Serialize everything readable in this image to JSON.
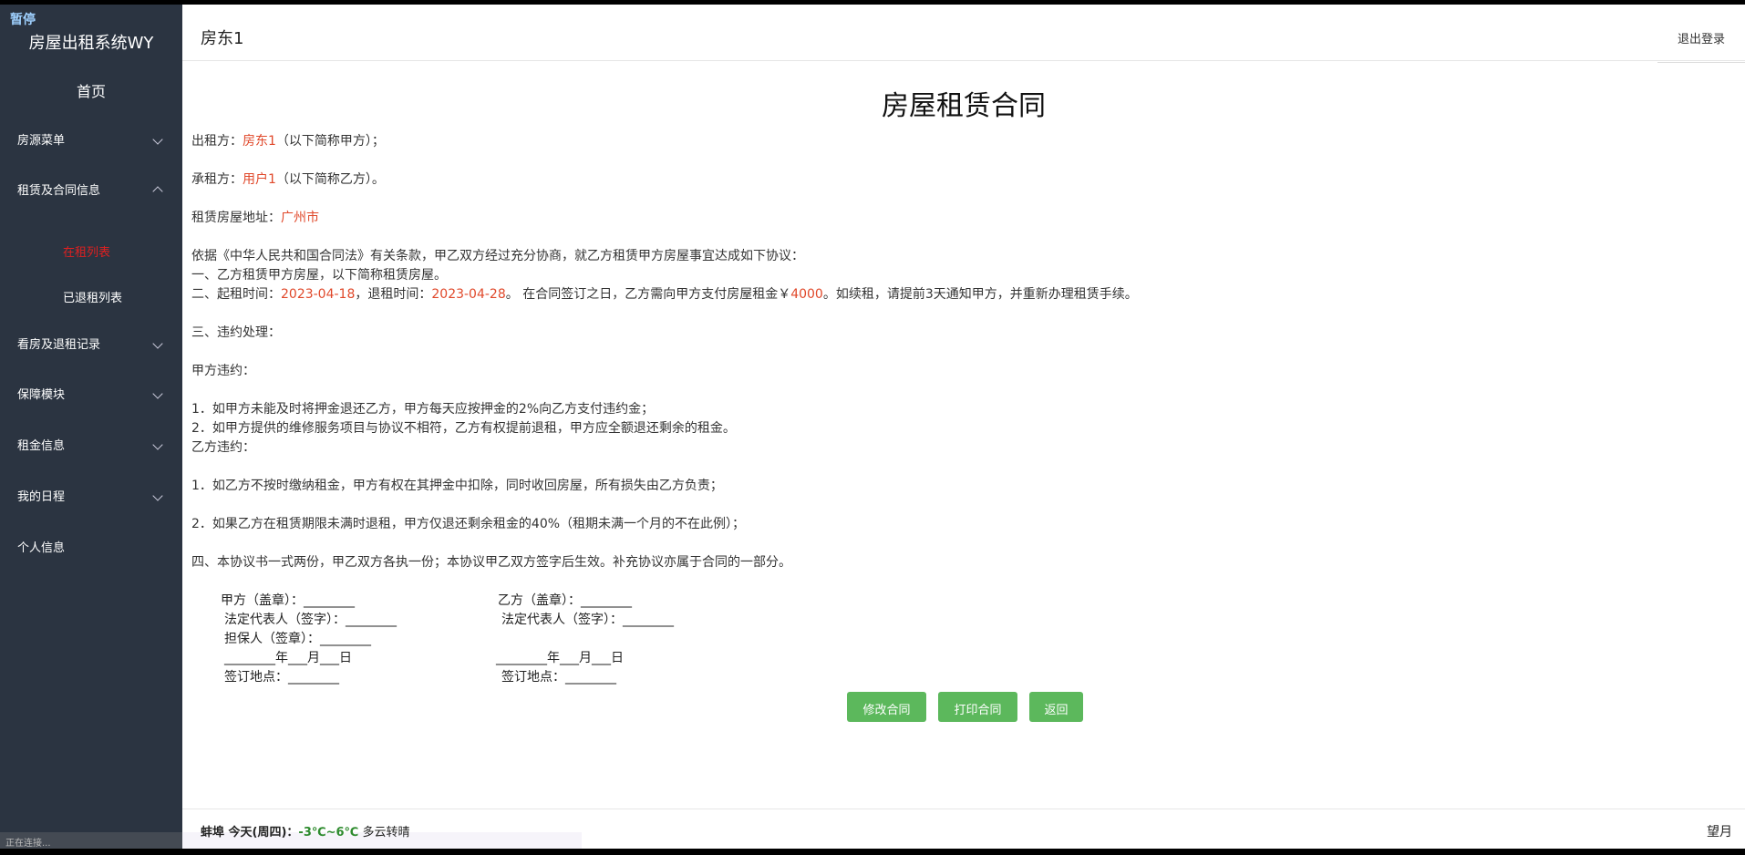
{
  "overlay": {
    "paused": "暂停"
  },
  "sidebar": {
    "app_title": "房屋出租系统WY",
    "home": "首页",
    "menus": [
      {
        "label": "房源菜单",
        "expanded": false
      },
      {
        "label": "租赁及合同信息",
        "expanded": true
      },
      {
        "label": "看房及退租记录",
        "expanded": false
      },
      {
        "label": "保障模块",
        "expanded": false
      },
      {
        "label": "租金信息",
        "expanded": false
      },
      {
        "label": "我的日程",
        "expanded": false
      },
      {
        "label": "个人信息",
        "expanded": false
      }
    ],
    "submenu": [
      {
        "label": "在租列表",
        "active": true
      },
      {
        "label": "已退租列表",
        "active": false
      }
    ],
    "status": "正在连接..."
  },
  "header": {
    "user": "房东1",
    "logout": "退出登录"
  },
  "contract": {
    "title": "房屋租赁合同",
    "lessor_prefix": "出租方：",
    "lessor": "房东1",
    "lessor_suffix": "（以下简称甲方）；",
    "lessee_prefix": "承租方：",
    "lessee": "用户1",
    "lessee_suffix": "（以下简称乙方）。",
    "address_prefix": "租赁房屋地址：",
    "address": "广州市",
    "intro": "依据《中华人民共和国合同法》有关条款，甲乙双方经过充分协商，就乙方租赁甲方房屋事宜达成如下协议：",
    "clause1": "一、乙方租赁甲方房屋，以下简称租赁房屋。",
    "clause2_a": "二、起租时间：",
    "start_date": "2023-04-18",
    "clause2_b": "，退租时间：",
    "end_date": "2023-04-28",
    "clause2_c": "。 在合同签订之日，乙方需向甲方支付房屋租金￥",
    "rent": "4000",
    "clause2_d": "。如续租，请提前3天通知甲方，并重新办理租赁手续。",
    "clause3": "三、违约处理：",
    "partyA_breach": "甲方违约：",
    "a1": "1．如甲方未能及时将押金退还乙方，甲方每天应按押金的2%向乙方支付违约金；",
    "a2": "2．如甲方提供的维修服务项目与协议不相符，乙方有权提前退租，甲方应全额退还剩余的租金。",
    "partyB_breach": "乙方违约：",
    "b1": "1．如乙方不按时缴纳租金，甲方有权在其押金中扣除，同时收回房屋，所有损失由乙方负责；",
    "b2": "2．如果乙方在租赁期限未满时退租，甲方仅退还剩余租金的40%（租期未满一个月的不在此例）；",
    "clause4": "四、本协议书一式两份，甲乙双方各执一份；本协议甲乙双方签字后生效。补充协议亦属于合同的一部分。"
  },
  "signatures": {
    "left": {
      "party": "甲方（盖章）：________",
      "rep": "法定代表人（签字）：________",
      "guarantor": "担保人（签章）：________",
      "date": "________年___月___日",
      "place": "签订地点：________"
    },
    "right": {
      "party": "乙方（盖章）：________",
      "rep": "法定代表人（签字）：________",
      "date": "________年___月___日",
      "place": "签订地点：________"
    }
  },
  "buttons": {
    "edit": "修改合同",
    "print": "打印合同",
    "back": "返回"
  },
  "footer": {
    "city_day": "蚌埠 今天(周四)：",
    "temp": "-3℃~6℃",
    "condition": "多云转晴",
    "moon": "望月"
  },
  "colors": {
    "sidebar_bg": "#2b3441",
    "highlight": "#e0482a",
    "button": "#5cb85c",
    "active_menu": "#e02020"
  }
}
